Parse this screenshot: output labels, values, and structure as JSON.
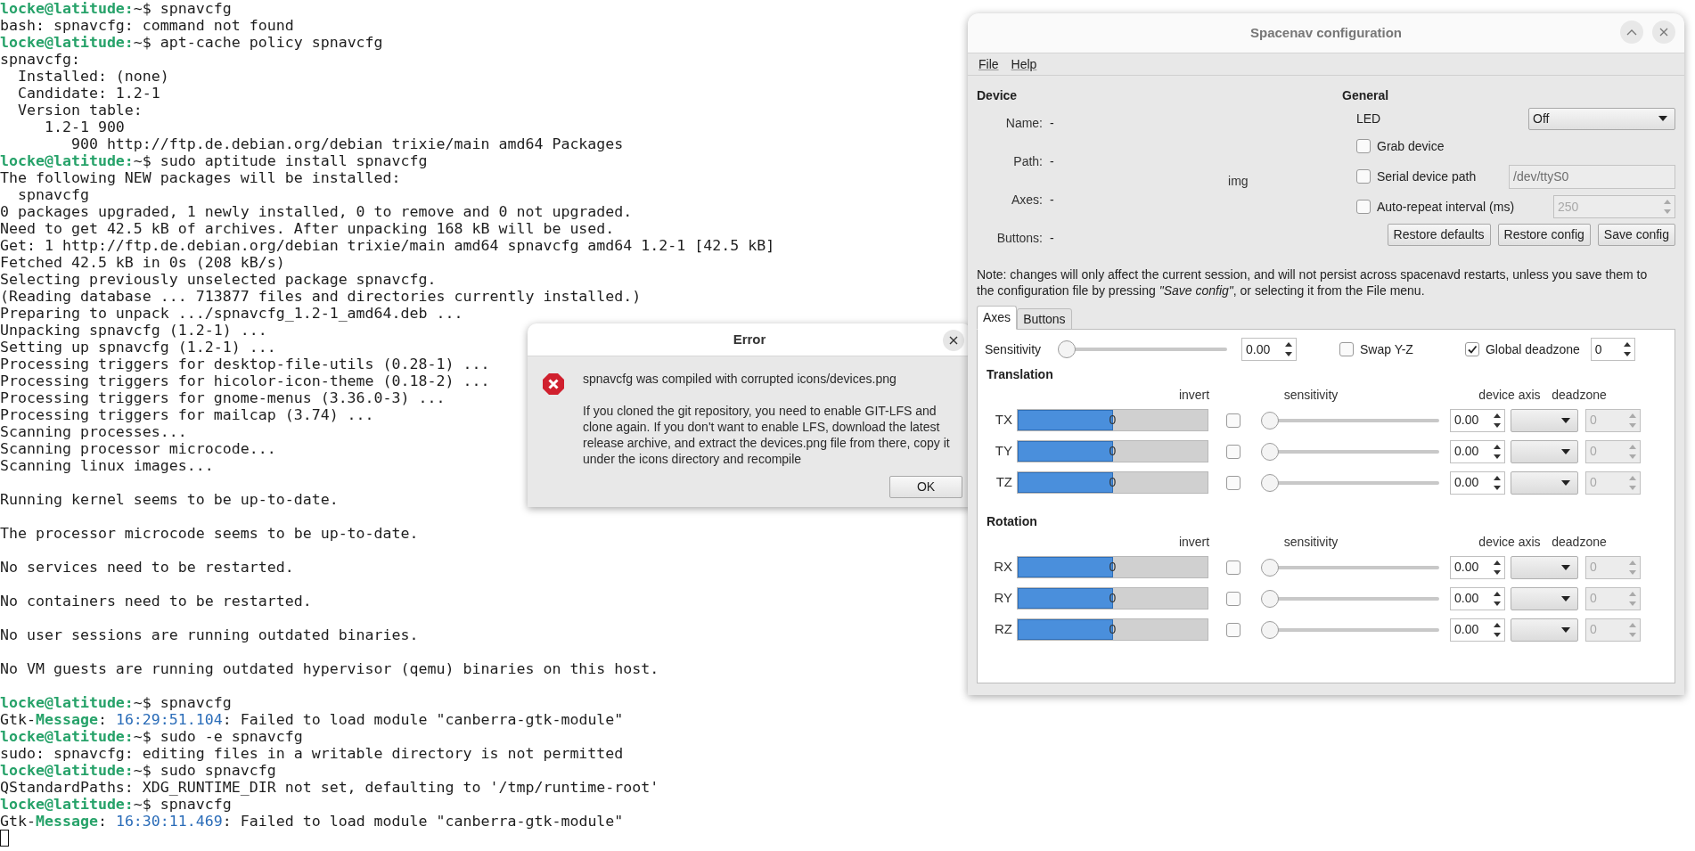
{
  "terminal": {
    "lines": [
      {
        "kind": "line",
        "spans": [
          {
            "kind": "prompt",
            "text": "locke@latitude:"
          },
          {
            "kind": "plain",
            "text": "~$ spnavcfg"
          }
        ]
      },
      {
        "kind": "line",
        "spans": [
          {
            "kind": "plain",
            "text": "bash: spnavcfg: command not found"
          }
        ]
      },
      {
        "kind": "line",
        "spans": [
          {
            "kind": "prompt",
            "text": "locke@latitude:"
          },
          {
            "kind": "plain",
            "text": "~$ apt-cache policy spnavcfg"
          }
        ]
      },
      {
        "kind": "line",
        "spans": [
          {
            "kind": "plain",
            "text": "spnavcfg:"
          }
        ]
      },
      {
        "kind": "line",
        "spans": [
          {
            "kind": "plain",
            "text": "  Installed: (none)"
          }
        ]
      },
      {
        "kind": "line",
        "spans": [
          {
            "kind": "plain",
            "text": "  Candidate: 1.2-1"
          }
        ]
      },
      {
        "kind": "line",
        "spans": [
          {
            "kind": "plain",
            "text": "  Version table:"
          }
        ]
      },
      {
        "kind": "line",
        "spans": [
          {
            "kind": "plain",
            "text": "     1.2-1 900"
          }
        ]
      },
      {
        "kind": "line",
        "spans": [
          {
            "kind": "plain",
            "text": "        900 http://ftp.de.debian.org/debian trixie/main amd64 Packages"
          }
        ]
      },
      {
        "kind": "line",
        "spans": [
          {
            "kind": "prompt",
            "text": "locke@latitude:"
          },
          {
            "kind": "plain",
            "text": "~$ sudo aptitude install spnavcfg"
          }
        ]
      },
      {
        "kind": "line",
        "spans": [
          {
            "kind": "plain",
            "text": "The following NEW packages will be installed:"
          }
        ]
      },
      {
        "kind": "line",
        "spans": [
          {
            "kind": "plain",
            "text": "  spnavcfg"
          }
        ]
      },
      {
        "kind": "line",
        "spans": [
          {
            "kind": "plain",
            "text": "0 packages upgraded, 1 newly installed, 0 to remove and 0 not upgraded."
          }
        ]
      },
      {
        "kind": "line",
        "spans": [
          {
            "kind": "plain",
            "text": "Need to get 42.5 kB of archives. After unpacking 168 kB will be used."
          }
        ]
      },
      {
        "kind": "line",
        "spans": [
          {
            "kind": "plain",
            "text": "Get: 1 http://ftp.de.debian.org/debian trixie/main amd64 spnavcfg amd64 1.2-1 [42.5 kB]"
          }
        ]
      },
      {
        "kind": "line",
        "spans": [
          {
            "kind": "plain",
            "text": "Fetched 42.5 kB in 0s (208 kB/s)"
          }
        ]
      },
      {
        "kind": "line",
        "spans": [
          {
            "kind": "plain",
            "text": "Selecting previously unselected package spnavcfg."
          }
        ]
      },
      {
        "kind": "line",
        "spans": [
          {
            "kind": "plain",
            "text": "(Reading database ... 713877 files and directories currently installed.)"
          }
        ]
      },
      {
        "kind": "line",
        "spans": [
          {
            "kind": "plain",
            "text": "Preparing to unpack .../spnavcfg_1.2-1_amd64.deb ..."
          }
        ]
      },
      {
        "kind": "line",
        "spans": [
          {
            "kind": "plain",
            "text": "Unpacking spnavcfg (1.2-1) ..."
          }
        ]
      },
      {
        "kind": "line",
        "spans": [
          {
            "kind": "plain",
            "text": "Setting up spnavcfg (1.2-1) ..."
          }
        ]
      },
      {
        "kind": "line",
        "spans": [
          {
            "kind": "plain",
            "text": "Processing triggers for desktop-file-utils (0.28-1) ..."
          }
        ]
      },
      {
        "kind": "line",
        "spans": [
          {
            "kind": "plain",
            "text": "Processing triggers for hicolor-icon-theme (0.18-2) ..."
          }
        ]
      },
      {
        "kind": "line",
        "spans": [
          {
            "kind": "plain",
            "text": "Processing triggers for gnome-menus (3.36.0-3) ..."
          }
        ]
      },
      {
        "kind": "line",
        "spans": [
          {
            "kind": "plain",
            "text": "Processing triggers for mailcap (3.74) ..."
          }
        ]
      },
      {
        "kind": "line",
        "spans": [
          {
            "kind": "plain",
            "text": "Scanning processes..."
          }
        ]
      },
      {
        "kind": "line",
        "spans": [
          {
            "kind": "plain",
            "text": "Scanning processor microcode..."
          }
        ]
      },
      {
        "kind": "line",
        "spans": [
          {
            "kind": "plain",
            "text": "Scanning linux images..."
          }
        ]
      },
      {
        "kind": "blank"
      },
      {
        "kind": "line",
        "spans": [
          {
            "kind": "plain",
            "text": "Running kernel seems to be up-to-date."
          }
        ]
      },
      {
        "kind": "blank"
      },
      {
        "kind": "line",
        "spans": [
          {
            "kind": "plain",
            "text": "The processor microcode seems to be up-to-date."
          }
        ]
      },
      {
        "kind": "blank"
      },
      {
        "kind": "line",
        "spans": [
          {
            "kind": "plain",
            "text": "No services need to be restarted."
          }
        ]
      },
      {
        "kind": "blank"
      },
      {
        "kind": "line",
        "spans": [
          {
            "kind": "plain",
            "text": "No containers need to be restarted."
          }
        ]
      },
      {
        "kind": "blank"
      },
      {
        "kind": "line",
        "spans": [
          {
            "kind": "plain",
            "text": "No user sessions are running outdated binaries."
          }
        ]
      },
      {
        "kind": "blank"
      },
      {
        "kind": "line",
        "spans": [
          {
            "kind": "plain",
            "text": "No VM guests are running outdated hypervisor (qemu) binaries on this host."
          }
        ]
      },
      {
        "kind": "blank"
      },
      {
        "kind": "line",
        "spans": [
          {
            "kind": "prompt",
            "text": "locke@latitude:"
          },
          {
            "kind": "plain",
            "text": "~$ spnavcfg"
          }
        ]
      },
      {
        "kind": "line",
        "spans": [
          {
            "kind": "plain",
            "text": "Gtk-"
          },
          {
            "kind": "tag",
            "text": "Message"
          },
          {
            "kind": "plain",
            "text": ": "
          },
          {
            "kind": "time",
            "text": "16:29:51.104"
          },
          {
            "kind": "plain",
            "text": ": Failed to load module \"canberra-gtk-module\""
          }
        ]
      },
      {
        "kind": "line",
        "spans": [
          {
            "kind": "prompt",
            "text": "locke@latitude:"
          },
          {
            "kind": "plain",
            "text": "~$ sudo -e spnavcfg"
          }
        ]
      },
      {
        "kind": "line",
        "spans": [
          {
            "kind": "plain",
            "text": "sudo: spnavcfg: editing files in a writable directory is not permitted"
          }
        ]
      },
      {
        "kind": "line",
        "spans": [
          {
            "kind": "prompt",
            "text": "locke@latitude:"
          },
          {
            "kind": "plain",
            "text": "~$ sudo spnavcfg"
          }
        ]
      },
      {
        "kind": "line",
        "spans": [
          {
            "kind": "plain",
            "text": "QStandardPaths: XDG_RUNTIME_DIR not set, defaulting to '/tmp/runtime-root'"
          }
        ]
      },
      {
        "kind": "line",
        "spans": [
          {
            "kind": "prompt",
            "text": "locke@latitude:"
          },
          {
            "kind": "plain",
            "text": "~$ spnavcfg"
          }
        ]
      },
      {
        "kind": "line",
        "spans": [
          {
            "kind": "plain",
            "text": "Gtk-"
          },
          {
            "kind": "tag",
            "text": "Message"
          },
          {
            "kind": "plain",
            "text": ": "
          },
          {
            "kind": "time",
            "text": "16:30:11.469"
          },
          {
            "kind": "plain",
            "text": ": Failed to load module \"canberra-gtk-module\""
          }
        ]
      }
    ]
  },
  "error_dialog": {
    "title": "Error",
    "heading": "spnavcfg was compiled with corrupted icons/devices.png",
    "body": "If you cloned the git repository, you need to enable GIT-LFS and clone again. If you don't want to enable LFS, download the latest release archive, and extract the devices.png file from there, copy it under the icons directory and recompile",
    "button": "OK"
  },
  "config_window": {
    "title": "Spacenav configuration",
    "menu": [
      "File",
      "Help"
    ],
    "device": {
      "heading": "Device",
      "fields": [
        {
          "label": "Name:",
          "reading": "-"
        },
        {
          "label": "Path:",
          "reading": "-"
        },
        {
          "label": "Axes:",
          "reading": "-"
        },
        {
          "label": "Buttons:",
          "reading": "-"
        }
      ],
      "image_text": "img"
    },
    "general": {
      "heading": "General",
      "led_label": "LED",
      "led_value": "Off",
      "options": [
        {
          "kind": "checkbox",
          "label": "Grab device",
          "checked": false
        },
        {
          "kind": "text",
          "label": "Serial device path",
          "checked": false,
          "value": "/dev/ttyS0"
        },
        {
          "kind": "spin",
          "label": "Auto-repeat interval (ms)",
          "checked": false,
          "value": "250"
        }
      ],
      "buttons": [
        "Restore defaults",
        "Restore config",
        "Save config"
      ]
    },
    "note": "Note: changes will only affect the current session, and will not persist across spacenavd restarts, unless you save them to the configuration file by pressing *\"Save config\"*, or selecting it from the File menu.",
    "tabs": [
      {
        "label": "Axes",
        "selected": true
      },
      {
        "label": "Buttons",
        "selected": false
      }
    ],
    "axes": {
      "sensitivity_label": "Sensitivity",
      "sensitivity_slider": {
        "level": 0
      },
      "sensitivity_value": "0.00",
      "swap_label": "Swap Y-Z",
      "swap_checked": false,
      "deadzone_label": "Global deadzone",
      "deadzone_checked": true,
      "deadzone_value": "0",
      "groups": [
        {
          "title": "Translation",
          "columns": [
            "invert",
            "sensitivity",
            "device axis",
            "deadzone"
          ],
          "rows": [
            {
              "label": "TX",
              "level": 0.5,
              "reading": "0",
              "invert": false,
              "sensitivity": {
                "level": 0
              },
              "value": "0.00",
              "deadzone": "0"
            },
            {
              "label": "TY",
              "level": 0.5,
              "reading": "0",
              "invert": false,
              "sensitivity": {
                "level": 0
              },
              "value": "0.00",
              "deadzone": "0"
            },
            {
              "label": "TZ",
              "level": 0.5,
              "reading": "0",
              "invert": false,
              "sensitivity": {
                "level": 0
              },
              "value": "0.00",
              "deadzone": "0"
            }
          ]
        },
        {
          "title": "Rotation",
          "columns": [
            "invert",
            "sensitivity",
            "device axis",
            "deadzone"
          ],
          "rows": [
            {
              "label": "RX",
              "level": 0.5,
              "reading": "0",
              "invert": false,
              "sensitivity": {
                "level": 0
              },
              "value": "0.00",
              "deadzone": "0"
            },
            {
              "label": "RY",
              "level": 0.5,
              "reading": "0",
              "invert": false,
              "sensitivity": {
                "level": 0
              },
              "value": "0.00",
              "deadzone": "0"
            },
            {
              "label": "RZ",
              "level": 0.5,
              "reading": "0",
              "invert": false,
              "sensitivity": {
                "level": 0
              },
              "value": "0.00",
              "deadzone": "0"
            }
          ]
        }
      ]
    }
  }
}
